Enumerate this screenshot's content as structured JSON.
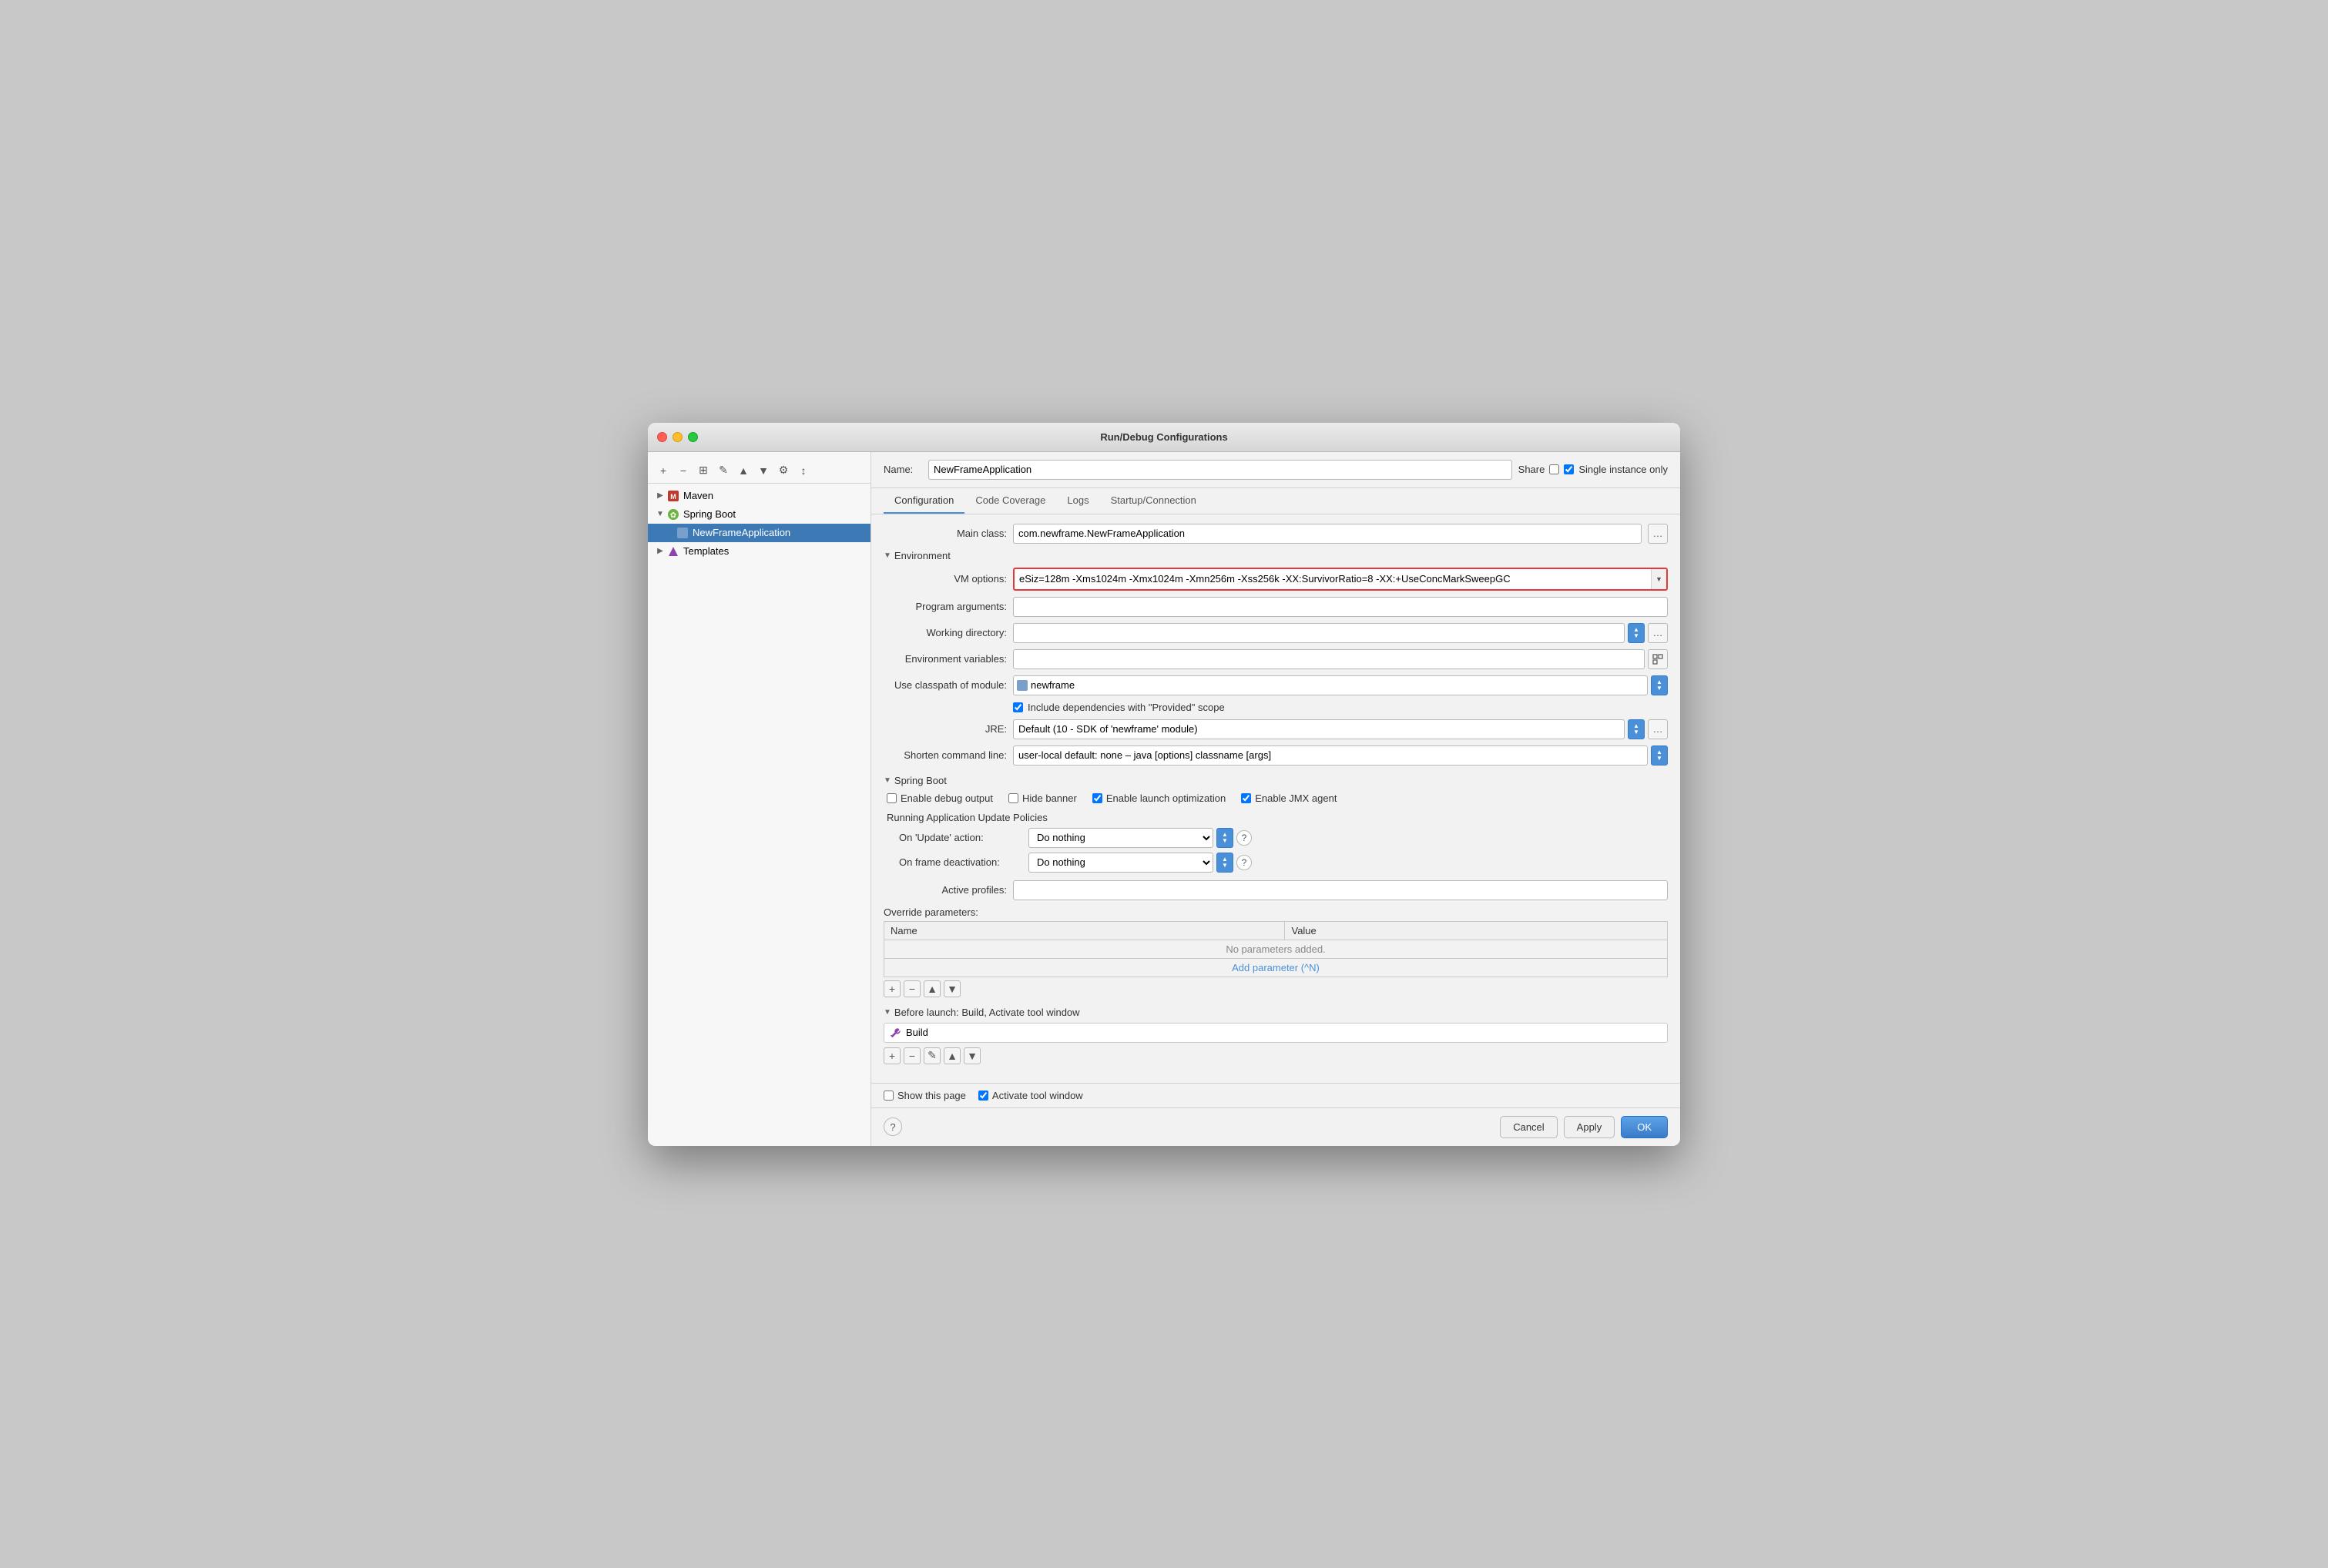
{
  "window": {
    "title": "Run/Debug Configurations"
  },
  "sidebar": {
    "toolbar_buttons": [
      "+",
      "−",
      "⊞",
      "✎",
      "▲",
      "▼",
      "⚙",
      "↕"
    ],
    "items": [
      {
        "id": "maven",
        "label": "Maven",
        "indent": 0,
        "type": "group",
        "arrow": "▶"
      },
      {
        "id": "springboot",
        "label": "Spring Boot",
        "indent": 0,
        "type": "group",
        "arrow": "▼",
        "selected": false
      },
      {
        "id": "newframe",
        "label": "NewFrameApplication",
        "indent": 2,
        "type": "app",
        "selected": true
      },
      {
        "id": "templates",
        "label": "Templates",
        "indent": 0,
        "type": "template",
        "arrow": "▶"
      }
    ]
  },
  "name_row": {
    "label": "Name:",
    "value": "NewFrameApplication",
    "share_label": "Share",
    "single_instance_label": "Single instance only",
    "single_instance_checked": true
  },
  "tabs": [
    {
      "id": "configuration",
      "label": "Configuration",
      "active": true
    },
    {
      "id": "code_coverage",
      "label": "Code Coverage",
      "active": false
    },
    {
      "id": "logs",
      "label": "Logs",
      "active": false
    },
    {
      "id": "startup_connection",
      "label": "Startup/Connection",
      "active": false
    }
  ],
  "configuration": {
    "main_class_label": "Main class:",
    "main_class_value": "com.newframe.NewFrameApplication",
    "environment_section": "Environment",
    "vm_options_label": "VM options:",
    "vm_options_value": "eSiz=128m -Xms1024m -Xmx1024m -Xmn256m -Xss256k -XX:SurvivorRatio=8 -XX:+UseConcMarkSweepGC",
    "program_args_label": "Program arguments:",
    "program_args_value": "",
    "working_dir_label": "Working directory:",
    "working_dir_value": "",
    "env_vars_label": "Environment variables:",
    "env_vars_value": "",
    "module_label": "Use classpath of module:",
    "module_value": "newframe",
    "include_deps_label": "Include dependencies with \"Provided\" scope",
    "include_deps_checked": true,
    "jre_label": "JRE:",
    "jre_value": "Default (10 - SDK of 'newframe' module)",
    "shorten_cmd_label": "Shorten command line:",
    "shorten_cmd_value": "user-local default: none – java [options] classname [args]",
    "springboot_section": "Spring Boot",
    "enable_debug_label": "Enable debug output",
    "enable_debug_checked": false,
    "hide_banner_label": "Hide banner",
    "hide_banner_checked": false,
    "enable_launch_label": "Enable launch optimization",
    "enable_launch_checked": true,
    "enable_jmx_label": "Enable JMX agent",
    "enable_jmx_checked": true,
    "running_policies_title": "Running Application Update Policies",
    "on_update_label": "On 'Update' action:",
    "on_update_value": "Do nothing",
    "on_frame_label": "On frame deactivation:",
    "on_frame_value": "Do nothing",
    "active_profiles_label": "Active profiles:",
    "active_profiles_value": "",
    "override_params_label": "Override parameters:",
    "table_headers": [
      "Name",
      "Value"
    ],
    "table_empty_msg": "No parameters added.",
    "table_add_link": "Add parameter (^N)",
    "before_launch_title": "Before launch: Build, Activate tool window",
    "build_item": "Build",
    "show_page_label": "Show this page",
    "show_page_checked": false,
    "activate_tool_label": "Activate tool window",
    "activate_tool_checked": true
  },
  "bottom_bar": {
    "cancel_label": "Cancel",
    "apply_label": "Apply",
    "ok_label": "OK"
  }
}
